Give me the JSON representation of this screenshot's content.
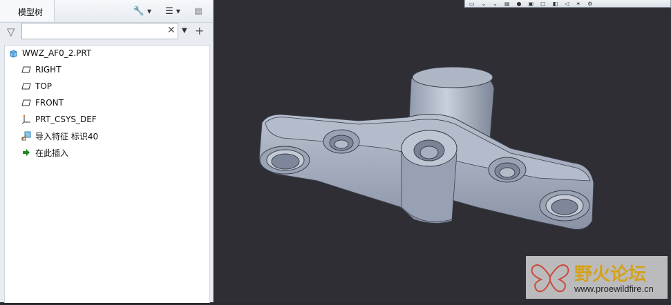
{
  "panel": {
    "tab_title": "模型树"
  },
  "search": {
    "value": "",
    "placeholder": ""
  },
  "tree": {
    "root": "WWZ_AF0_2.PRT",
    "items": [
      {
        "label": "RIGHT",
        "icon": "datum-plane-icon"
      },
      {
        "label": "TOP",
        "icon": "datum-plane-icon"
      },
      {
        "label": "FRONT",
        "icon": "datum-plane-icon"
      },
      {
        "label": "PRT_CSYS_DEF",
        "icon": "coordinate-system-icon"
      },
      {
        "label": "导入特征 标识40",
        "icon": "import-feature-icon"
      },
      {
        "label": "在此插入",
        "icon": "insert-here-arrow-icon"
      }
    ]
  },
  "watermark": {
    "title": "野火论坛",
    "url": "www.proewildfire.cn"
  },
  "colors": {
    "viewport_bg": "#2e2e34",
    "model_fill": "#a9b2c4",
    "insert_arrow": "#1e8a1e"
  }
}
